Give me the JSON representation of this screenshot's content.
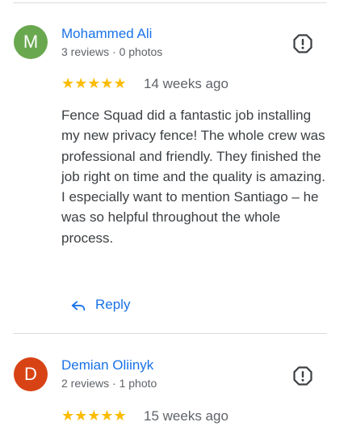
{
  "reviews": [
    {
      "initial": "M",
      "avatar_color": "#6aa84f",
      "name": "Mohammed Ali",
      "meta": "3 reviews · 0 photos",
      "stars": "★★★★★",
      "rating": 5,
      "date": "14 weeks ago",
      "text": "Fence Squad did a fantastic job installing my new privacy fence! The whole crew was professional and friendly. They finished the job right on time and the quality is amazing. I especially want to mention Santiago – he was so helpful throughout the whole process.",
      "reply_label": "Reply"
    },
    {
      "initial": "D",
      "avatar_color": "#d84315",
      "name": "Demian Oliinyk",
      "meta": "2 reviews · 1 photo",
      "stars": "★★★★★",
      "rating": 5,
      "date": "15 weeks ago"
    }
  ],
  "icons": {
    "flag": "report-flag-icon",
    "reply": "reply-arrow-icon",
    "star": "star-icon"
  },
  "colors": {
    "link": "#1a73e8",
    "star": "#fbbc04",
    "secondary_text": "#5f6368"
  }
}
